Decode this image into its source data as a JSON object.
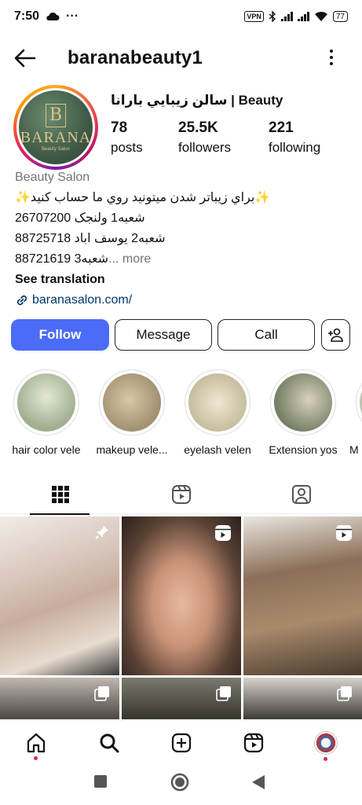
{
  "status_bar": {
    "time": "7:50",
    "dots": "···",
    "vpn": "VPN",
    "battery": "77"
  },
  "header": {
    "username": "baranabeauty1"
  },
  "profile": {
    "display_name": "سالن زیبایي بارانا | Beauty",
    "logo_text": "BARANA",
    "logo_letter": "B",
    "logo_sub": "Beauty Salon",
    "stats": [
      {
        "value": "78",
        "label": "posts"
      },
      {
        "value": "25.5K",
        "label": "followers"
      },
      {
        "value": "221",
        "label": "following"
      }
    ],
    "bio": {
      "category": "Beauty Salon",
      "line1": "✨براي زيباتر شدن ميتونيد روي ما حساب كنيد✨",
      "line2": "شعبه1 ولنجک  26707200",
      "line3": "شعبه2 یوسف اباد 88725718",
      "line4": "88721619 شعبه3",
      "more": "... more",
      "see_translation": "See translation",
      "link": "baranasalon.com/"
    }
  },
  "actions": {
    "follow": "Follow",
    "message": "Message",
    "call": "Call"
  },
  "highlights": [
    {
      "label": "hair color vele",
      "color": "#b7c3a8"
    },
    {
      "label": "makeup vele...",
      "color": "#b9ad8e"
    },
    {
      "label": "eyelash velen",
      "color": "#c9c2a6"
    },
    {
      "label": "Extension yos",
      "color": "#8f9a7e"
    },
    {
      "label": "M",
      "color": "#bcc7b0"
    }
  ],
  "colors": {
    "follow_button": "#4a6cf7",
    "link": "#00376b",
    "muted_text": "#737373"
  },
  "tabs": [
    "grid-icon",
    "reels-icon",
    "tagged-icon"
  ],
  "bottom_nav": [
    "home-icon",
    "search-icon",
    "create-icon",
    "reels-icon",
    "profile-avatar"
  ]
}
